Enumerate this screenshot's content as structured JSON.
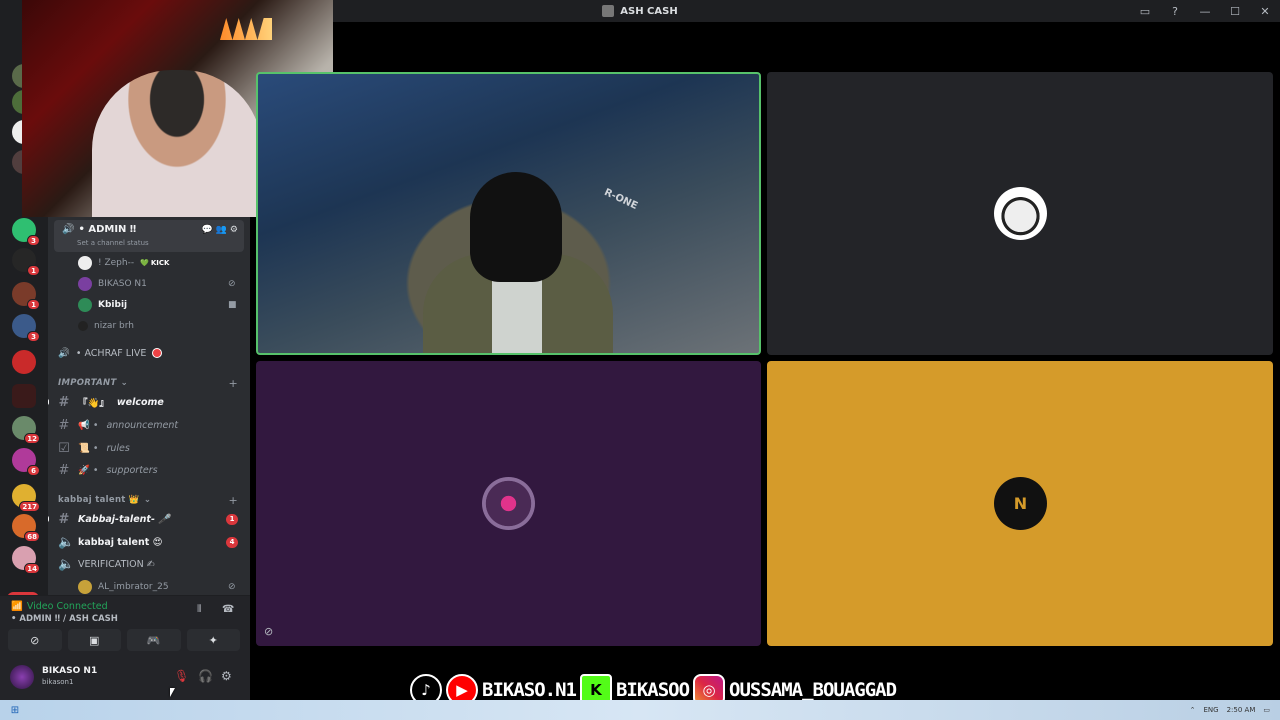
{
  "window": {
    "title": "ASH CASH"
  },
  "rail": {
    "badges": [
      "3",
      "1",
      "1",
      "3",
      "12",
      "6",
      "217",
      "68",
      "14"
    ],
    "new_label": "NEW"
  },
  "sidebar": {
    "header": {
      "channel_name": "• ADMIN ‼",
      "status": "Set a channel status"
    },
    "voice_members": [
      {
        "name": "! Zeph--",
        "tag": "KICK"
      },
      {
        "name": "BIKASO N1"
      },
      {
        "name": "Kbibij"
      },
      {
        "name": "nizar brh"
      }
    ],
    "voice_channel_achraf": "• ACHRAF LIVE",
    "category_important": "IMPORTANT",
    "important_channels": [
      {
        "label": "welcome",
        "prefix": "『👋』"
      },
      {
        "label": "announcement",
        "prefix": "📢 •"
      },
      {
        "label": "rules",
        "prefix": "📜 •"
      },
      {
        "label": "supporters",
        "prefix": "🚀 •"
      }
    ],
    "category_talent": "kabbaj talent 👑",
    "talent_channels": [
      {
        "label": "Kabbaj-talent- 🎤",
        "count": "1"
      },
      {
        "label": "kabbaj talent 😍",
        "count": "4"
      },
      {
        "label": "VERIFICATION ✍"
      }
    ],
    "last_member": "AL_imbrator_25"
  },
  "voice_panel": {
    "status": "Video Connected",
    "channel": "• ADMIN ‼ / ASH CASH"
  },
  "user_panel": {
    "name": "BIKASO N1",
    "handle": "bikason1"
  },
  "video_tiles": {
    "tile1_chair_text": "R-ONE",
    "tile4_logo_text": "N"
  },
  "social": {
    "handle1": "BIKASO.N1",
    "handle2": "BIKASOO",
    "handle3": "OUSSAMA_BOUAGGAD"
  },
  "taskbar": {
    "language": "ENG",
    "time": "2:50 AM"
  },
  "colors": {
    "connected_green": "#23a55a",
    "tile3_bg": "#32183f",
    "tile4_bg": "#d59b2a",
    "badge_red": "#da373c",
    "speaking_border": "#57c26b"
  }
}
